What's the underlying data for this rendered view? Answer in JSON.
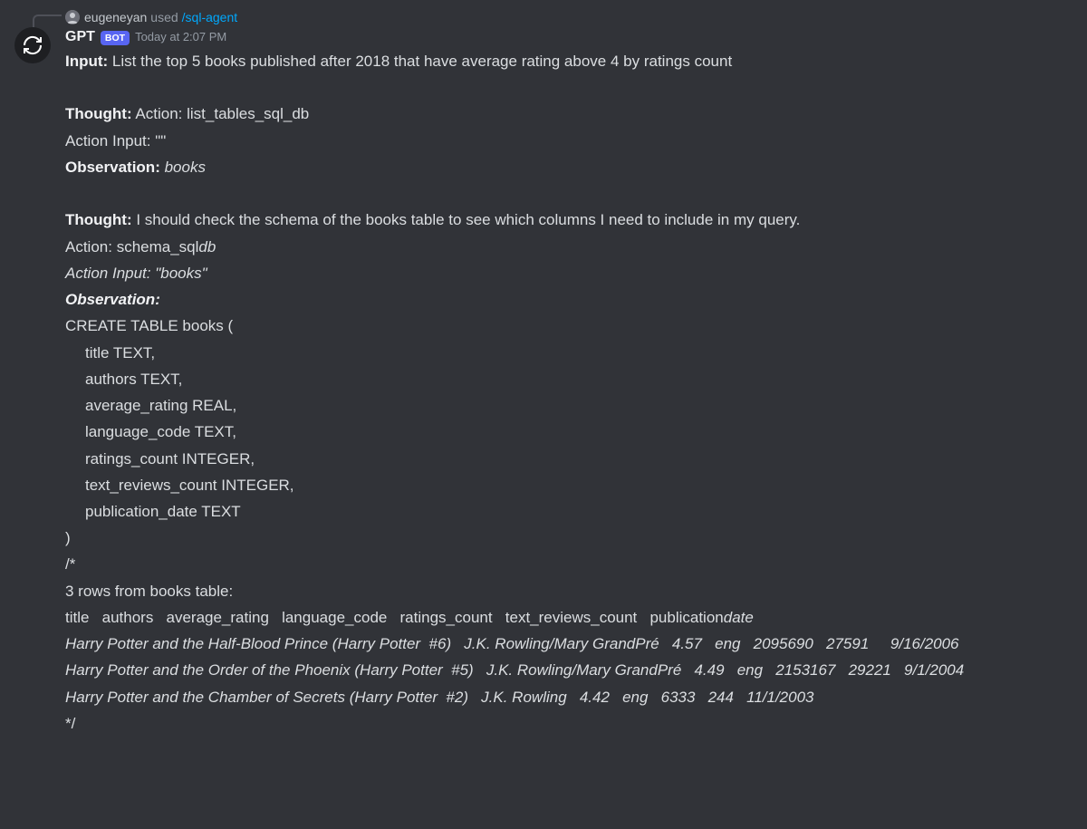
{
  "reply": {
    "username": "eugeneyan",
    "used_label": "used",
    "command": "/sql-agent"
  },
  "message": {
    "bot_name": "GPT",
    "bot_tag": "BOT",
    "timestamp": "Today at 2:07 PM"
  },
  "labels": {
    "input": "Input:",
    "thought": "Thought:",
    "action_input": "Action Input:",
    "observation": "Observation:",
    "action": "Action:"
  },
  "body": {
    "input_text": " List the top 5 books published after 2018 that have average rating above 4 by ratings count",
    "thought1_action": " Action: list_tables_sql_db",
    "action_input1": " \"\"",
    "observation1": "books",
    "thought2": " I should check the schema of the books table to see which columns I need to include in my query.",
    "action2_line": "Action: schema_sql",
    "action2_suffix": "db",
    "action_input2": "Action Input: \"books\"",
    "schema_l1": "CREATE TABLE books (",
    "schema_l2": "title TEXT,",
    "schema_l3": "authors TEXT,",
    "schema_l4": "average_rating REAL,",
    "schema_l5": "language_code TEXT,",
    "schema_l6": "ratings_count INTEGER,",
    "schema_l7": "text_reviews_count INTEGER,",
    "schema_l8": "publication_date TEXT",
    "schema_l9": ")",
    "comment_open": "/*",
    "rows_header": "3 rows from books table:",
    "cols_line_a": "title   authors   average_rating   language_code   ratings_count   text_reviews_count   publication",
    "cols_line_b": "date",
    "row1": "Harry Potter and the Half-Blood Prince (Harry Potter  #6)   J.K. Rowling/Mary GrandPré   4.57   eng   2095690   27591     9/16/2006",
    "row2": "Harry Potter and the Order of the Phoenix (Harry Potter  #5)   J.K. Rowling/Mary GrandPré   4.49   eng   2153167   29221   9/1/2004",
    "row3": "Harry Potter and the Chamber of Secrets (Harry Potter  #2)   J.K. Rowling   4.42   eng   6333   244   11/1/2003",
    "comment_close": "*/"
  }
}
